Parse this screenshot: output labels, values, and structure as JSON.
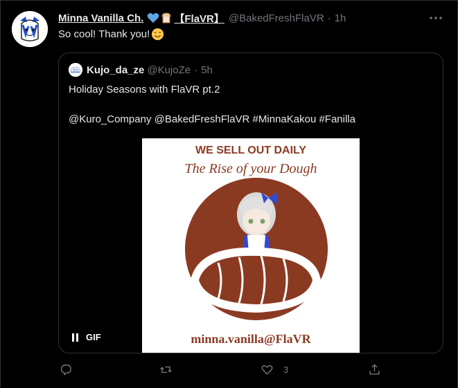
{
  "tweet": {
    "display_name": "Minna Vanilla Ch.",
    "name_tag": "【FlaVR】",
    "handle": "@BakedFreshFlaVR",
    "separator": "·",
    "time": "1h",
    "text": "So cool! Thank you!",
    "emoji_icon": "smiling-face-icon",
    "name_icons": [
      "blue-heart-icon",
      "bread-icon"
    ]
  },
  "quote": {
    "display_name": "Kujo_da_ze",
    "handle": "@KujoZe",
    "separator": "·",
    "time": "5h",
    "line1": "Holiday Seasons with FlaVR pt.2",
    "line2": "@Kuro_Company @BakedFreshFlaVR #MinnaKakou #Fanilla",
    "media": {
      "type": "gif",
      "badge": "GIF",
      "headline": "WE SELL OUT DAILY",
      "script_line": "The Rise of your Dough",
      "footer": "minna.vanilla@FlaVR"
    }
  },
  "actions": {
    "reply_count": "",
    "retweet_count": "",
    "like_count": "3",
    "share_count": ""
  },
  "colors": {
    "background": "#000000",
    "text": "#e7e9ea",
    "muted": "#71767b",
    "border": "#2f3336",
    "brand_brown": "#8b3a22",
    "heart_blue": "#5aa7e8"
  }
}
